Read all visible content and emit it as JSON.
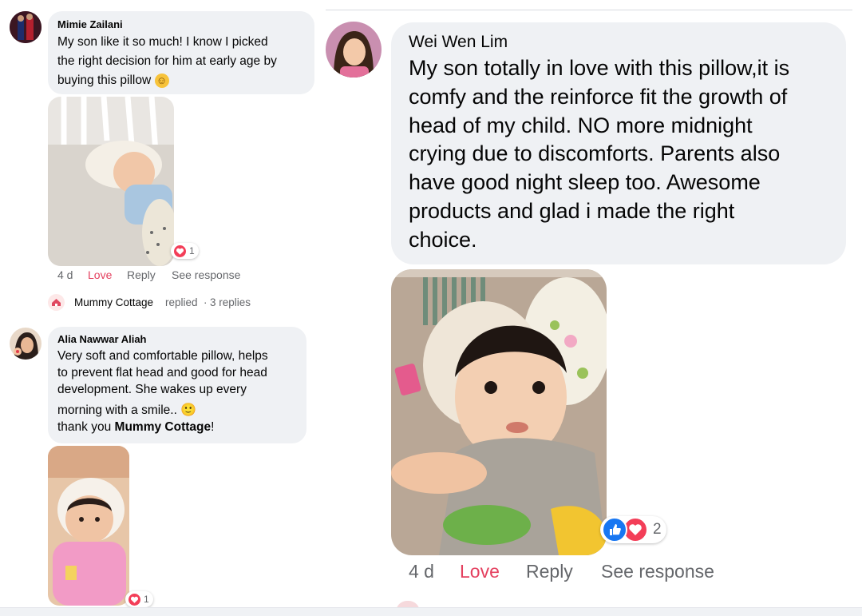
{
  "comments": [
    {
      "author": "Mimie Zailani",
      "text_lines": [
        "My son like it so much! I know I picked",
        "the right decision for him at early age by",
        "buying this pillow"
      ],
      "emoji": "☺",
      "time": "4 d",
      "love_label": "Love",
      "reply_label": "Reply",
      "see_response_label": "See response",
      "reaction_count": "1",
      "replies": {
        "author": "Mummy Cottage",
        "action": "replied",
        "separator": "·",
        "count_text": "3 replies"
      }
    },
    {
      "author": "Alia Nawwar Aliah",
      "text_lines": [
        "Very soft and comfortable pillow, helps",
        "to prevent flat head and good for head",
        "development. She wakes up every",
        "morning with a smile.."
      ],
      "emoji": "🙂",
      "closing_prefix": "thank you ",
      "closing_mention": "Mummy Cottage",
      "closing_suffix": "!",
      "reaction_count": "1"
    },
    {
      "author": "Wei Wen Lim",
      "text_lines": [
        "My son totally in love with this pillow,it is",
        "comfy and the reinforce fit the growth of",
        "head of my child. NO more midnight",
        "crying due to discomforts. Parents also",
        "have good night sleep too. Awesome",
        "products and glad i made the right",
        "choice."
      ],
      "time": "4 d",
      "love_label": "Love",
      "reply_label": "Reply",
      "see_response_label": "See response",
      "reaction_count": "2"
    }
  ],
  "colors": {
    "bubble": "#eff1f4",
    "love": "#e4405f",
    "meta": "#65676b",
    "like_blue": "#1877f2",
    "heart_red": "#f33e58"
  },
  "icons": [
    "heart-reaction-icon",
    "like-reaction-icon",
    "mummy-cottage-avatar-icon"
  ]
}
